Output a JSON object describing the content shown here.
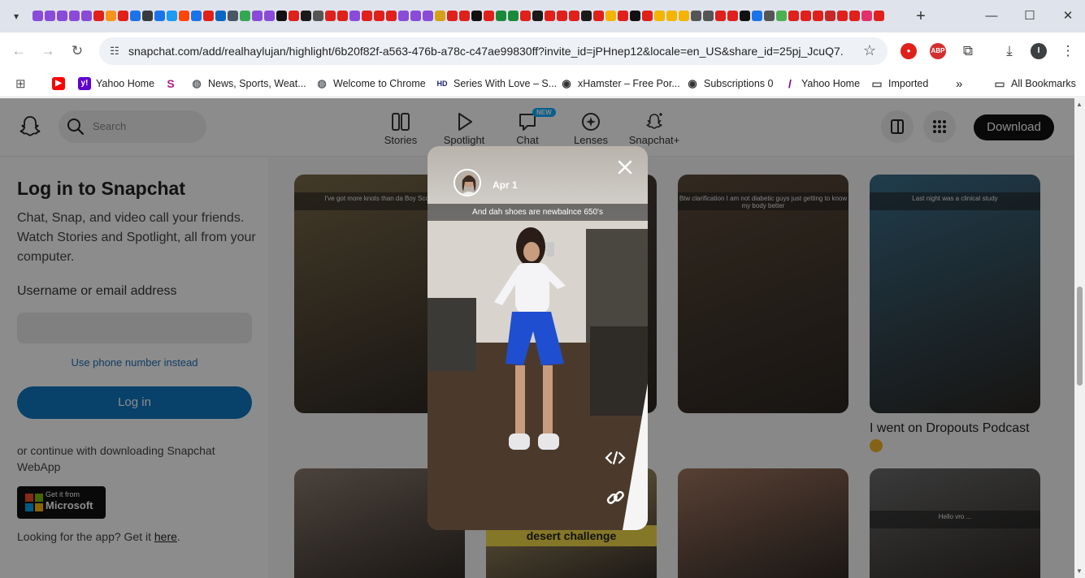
{
  "browser": {
    "url": "snapchat.com/add/realhaylujan/highlight/6b20f82f-a563-476b-a78c-c47ae99830ff?invite_id=jPHnep12&locale=en_US&share_id=25pj_JcuQ7...",
    "new_tab": "+",
    "window_controls": {
      "minimize": "—",
      "maximize": "☐",
      "close": "✕"
    },
    "tab_favicon_colors": [
      "#8a4bd8",
      "#8a4bd8",
      "#8a4bd8",
      "#8a4bd8",
      "#8a4bd8",
      "#e0201b",
      "#f7931a",
      "#e0201b",
      "#1a73e8",
      "#3a3a3a",
      "#1a73e8",
      "#1d9bf0",
      "#ff4500",
      "#1a73e8",
      "#e0201b",
      "#0a66c2",
      "#4b5563",
      "#32a852",
      "#8a4bd8",
      "#8a4bd8",
      "#111",
      "#e0201b",
      "#1a1a1a",
      "#555",
      "#e0201b",
      "#e0201b",
      "#8a4bd8",
      "#e0201b",
      "#e0201b",
      "#e0201b",
      "#8a4bd8",
      "#8a4bd8",
      "#8a4bd8",
      "#d4a017",
      "#e0201b",
      "#e0201b",
      "#111",
      "#e0201b",
      "#1a8a3a",
      "#1a8a3a",
      "#e0201b",
      "#1a1a1a",
      "#e0201b",
      "#e0201b",
      "#e0201b",
      "#1a1a1a",
      "#e0201b",
      "#f4b400",
      "#e0201b",
      "#111",
      "#e0201b",
      "#f4b400",
      "#f4b400",
      "#f4b400",
      "#555",
      "#555",
      "#e0201b",
      "#e0201b",
      "#111",
      "#1a73e8",
      "#555",
      "#4caf50",
      "#e0201b",
      "#e0201b",
      "#e0201b",
      "#c62828",
      "#e0201b",
      "#e0201b",
      "#e1306c",
      "#e0201b",
      "#e0201b",
      "#e0201b",
      "#e0201b",
      "#3949ab",
      "#e0201b",
      "#e0201b"
    ],
    "extensions": [
      {
        "label": "",
        "color": "#e0201b"
      },
      {
        "label": "ABP",
        "color": "#d32f2f"
      },
      {
        "label": "I",
        "color": "#3c4043"
      }
    ]
  },
  "bookmarks": [
    {
      "label": "",
      "icon": "youtube-icon",
      "color": "#ff0000",
      "glyph": "▶"
    },
    {
      "label": "Yahoo Home",
      "icon": "yahoo-icon",
      "color": "#5f01d1",
      "glyph": "y!"
    },
    {
      "label": "",
      "icon": "s-icon",
      "color": "#b41e8c",
      "glyph": "S"
    },
    {
      "label": "News, Sports, Weat...",
      "icon": "globe-icon",
      "color": "#5f6368",
      "glyph": "◍"
    },
    {
      "label": "Welcome to Chrome",
      "icon": "globe-icon",
      "color": "#5f6368",
      "glyph": "◍"
    },
    {
      "label": "Series With Love – S...",
      "icon": "hd-icon",
      "color": "#1a237e",
      "glyph": "HD"
    },
    {
      "label": "xHamster – Free Por...",
      "icon": "xhamster-icon",
      "color": "#333",
      "glyph": "◉"
    },
    {
      "label": "Subscriptions 0",
      "icon": "subscriptions-icon",
      "color": "#333",
      "glyph": "◉"
    },
    {
      "label": "Yahoo Home",
      "icon": "yahoo-icon",
      "color": "#7b0099",
      "glyph": "/"
    },
    {
      "label": "Imported",
      "icon": "folder-icon",
      "color": "#555",
      "glyph": "▭"
    },
    {
      "label": "»",
      "icon": "more-icon",
      "color": "#555",
      "glyph": ""
    },
    {
      "label": "All Bookmarks",
      "icon": "folder-icon",
      "color": "#555",
      "glyph": "▭"
    }
  ],
  "snapchat": {
    "search_placeholder": "Search",
    "nav": [
      {
        "label": "Stories",
        "icon": "stories-icon"
      },
      {
        "label": "Spotlight",
        "icon": "spotlight-icon"
      },
      {
        "label": "Chat",
        "icon": "chat-icon",
        "badge": "NEW"
      },
      {
        "label": "Lenses",
        "icon": "lenses-icon"
      },
      {
        "label": "Snapchat+",
        "icon": "snapchat-plus-icon"
      }
    ],
    "download_label": "Download",
    "login": {
      "title": "Log in to Snapchat",
      "description": "Chat, Snap, and video call your friends. Watch Stories and Spotlight, all from your computer.",
      "field_label": "Username or email address",
      "field_value": "",
      "phone_link": "Use phone number instead",
      "button": "Log in",
      "or_text": "or continue with downloading Snapchat WebApp",
      "ms_small": "Get it from",
      "ms_big": "Microsoft",
      "looking_prefix": "Looking for the app? Get it ",
      "looking_link": "here",
      "looking_suffix": "."
    },
    "cards": [
      {
        "caption": "I've got more knots than da Boy Sco...",
        "bg": "#7a6a4a"
      },
      {
        "caption": "",
        "bg": "#4a4036"
      },
      {
        "caption": "Btw clarification I am not diabetic guys just getting to know my body better",
        "bg": "#5b4a3a"
      },
      {
        "caption": "Last night was a clinical study",
        "bg": "#3b6e8a"
      },
      {
        "caption": "",
        "bg": "#8a7a6e"
      },
      {
        "caption": "desert challenge",
        "bg": "#c9b07a"
      },
      {
        "caption": "",
        "bg": "#a07560"
      },
      {
        "caption": "Hello vro ...",
        "bg": "#6b6b6b"
      }
    ],
    "card_title": "I went on Dropouts Podcast",
    "story": {
      "date": "Apr 1",
      "caption": "And dah shoes are newbalnce 650's"
    }
  }
}
